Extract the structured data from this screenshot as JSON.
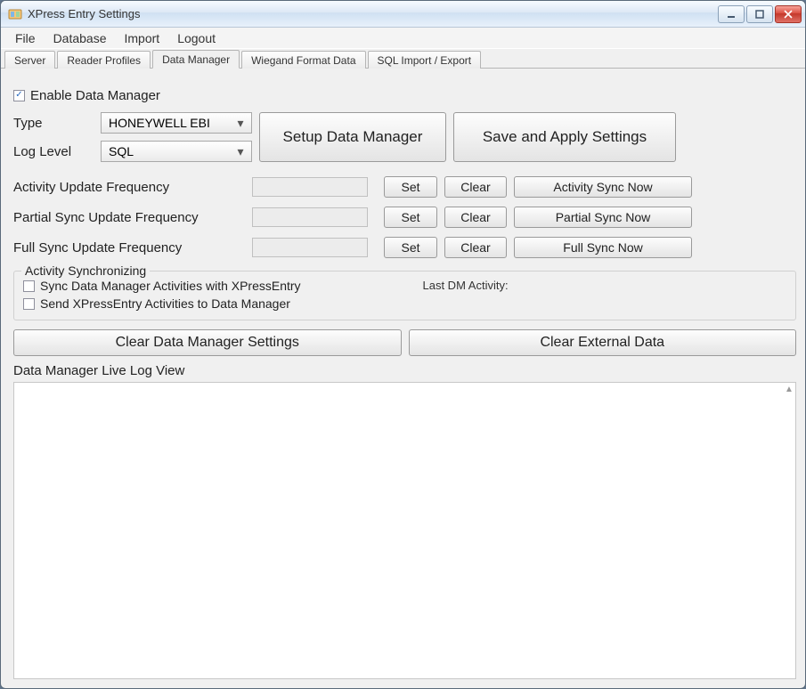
{
  "window": {
    "title": "XPress Entry Settings"
  },
  "menubar": {
    "items": [
      "File",
      "Database",
      "Import",
      "Logout"
    ]
  },
  "tabs": {
    "items": [
      "Server",
      "Reader Profiles",
      "Data Manager",
      "Wiegand Format Data",
      "SQL Import / Export"
    ],
    "active_index": 2
  },
  "enable_checkbox": {
    "label": "Enable Data Manager",
    "checked": true
  },
  "type_row": {
    "label": "Type",
    "value": "HONEYWELL EBI"
  },
  "loglevel_row": {
    "label": "Log Level",
    "value": "SQL"
  },
  "buttons": {
    "setup": "Setup Data Manager",
    "save_apply": "Save and Apply Settings",
    "clear_dm_settings": "Clear Data Manager Settings",
    "clear_external": "Clear External Data"
  },
  "freq": {
    "rows": [
      {
        "label": "Activity Update Frequency",
        "value": "",
        "set": "Set",
        "clear": "Clear",
        "now": "Activity Sync Now"
      },
      {
        "label": "Partial Sync Update Frequency",
        "value": "",
        "set": "Set",
        "clear": "Clear",
        "now": "Partial Sync Now"
      },
      {
        "label": "Full Sync Update Frequency",
        "value": "",
        "set": "Set",
        "clear": "Clear",
        "now": "Full Sync Now"
      }
    ]
  },
  "sync_group": {
    "legend": "Activity Synchronizing",
    "opt1": {
      "label": "Sync Data Manager Activities with XPressEntry",
      "checked": false
    },
    "opt2": {
      "label": "Send XPressEntry Activities to Data Manager",
      "checked": false
    },
    "last_dm_label": "Last DM Activity:",
    "last_dm_value": ""
  },
  "log_section": {
    "label": "Data Manager Live Log View"
  }
}
